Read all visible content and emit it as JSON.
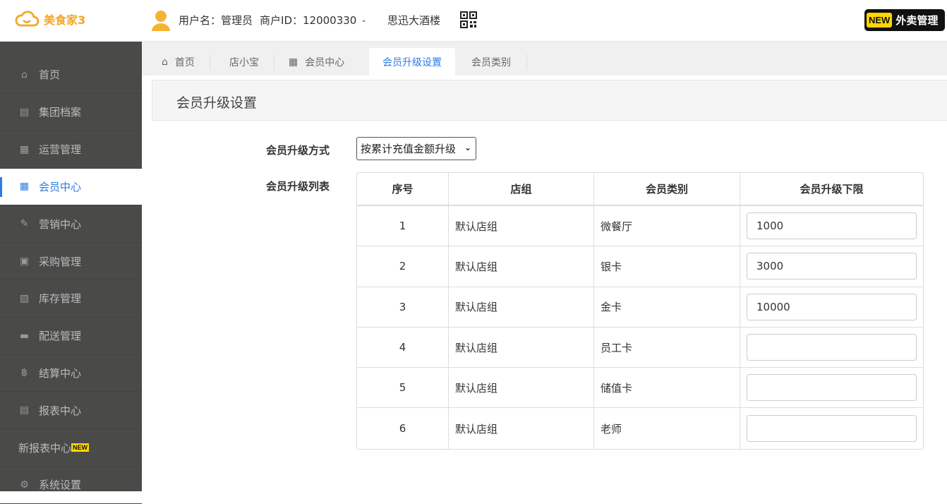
{
  "header": {
    "logo_text": "美食家3",
    "user_label": "用户名：管理员",
    "merchant_label": "商户ID：12000330",
    "store_name": "思迅大酒楼",
    "waimai_new": "NEW",
    "waimai_label": "外卖管理",
    "accent_color": "#f5a623"
  },
  "sidebar": {
    "items": [
      {
        "label": "首页",
        "icon": "home-icon"
      },
      {
        "label": "集团档案",
        "icon": "file-icon"
      },
      {
        "label": "运营管理",
        "icon": "bar-chart-icon"
      },
      {
        "label": "会员中心",
        "icon": "member-card-icon"
      },
      {
        "label": "营销中心",
        "icon": "edit-icon"
      },
      {
        "label": "采购管理",
        "icon": "book-icon"
      },
      {
        "label": "库存管理",
        "icon": "building-icon"
      },
      {
        "label": "配送管理",
        "icon": "truck-icon"
      },
      {
        "label": "结算中心",
        "icon": "bitcoin-icon"
      },
      {
        "label": "报表中心",
        "icon": "report-icon"
      },
      {
        "label": "新报表中心",
        "badge": "NEW"
      },
      {
        "label": "系统设置",
        "icon": "gears-icon"
      }
    ],
    "active_color": "#2d7be0"
  },
  "tabs": [
    {
      "label": "首页",
      "icon": "home-icon"
    },
    {
      "label": "店小宝"
    },
    {
      "label": "会员中心",
      "icon": "member-card-icon"
    },
    {
      "label": "会员升级设置",
      "active": true
    },
    {
      "label": "会员类别"
    }
  ],
  "panel": {
    "title": "会员升级设置"
  },
  "form": {
    "method_label": "会员升级方式",
    "method_value": "按累计充值金额升级",
    "list_label": "会员升级列表"
  },
  "table": {
    "headers": [
      "序号",
      "店组",
      "会员类别",
      "会员升级下限"
    ],
    "rows": [
      {
        "no": "1",
        "group": "默认店组",
        "type": "微餐厅",
        "limit": "1000"
      },
      {
        "no": "2",
        "group": "默认店组",
        "type": "银卡",
        "limit": "3000"
      },
      {
        "no": "3",
        "group": "默认店组",
        "type": "金卡",
        "limit": "10000"
      },
      {
        "no": "4",
        "group": "默认店组",
        "type": "员工卡",
        "limit": ""
      },
      {
        "no": "5",
        "group": "默认店组",
        "type": "储值卡",
        "limit": ""
      },
      {
        "no": "6",
        "group": "默认店组",
        "type": "老师",
        "limit": ""
      }
    ]
  }
}
